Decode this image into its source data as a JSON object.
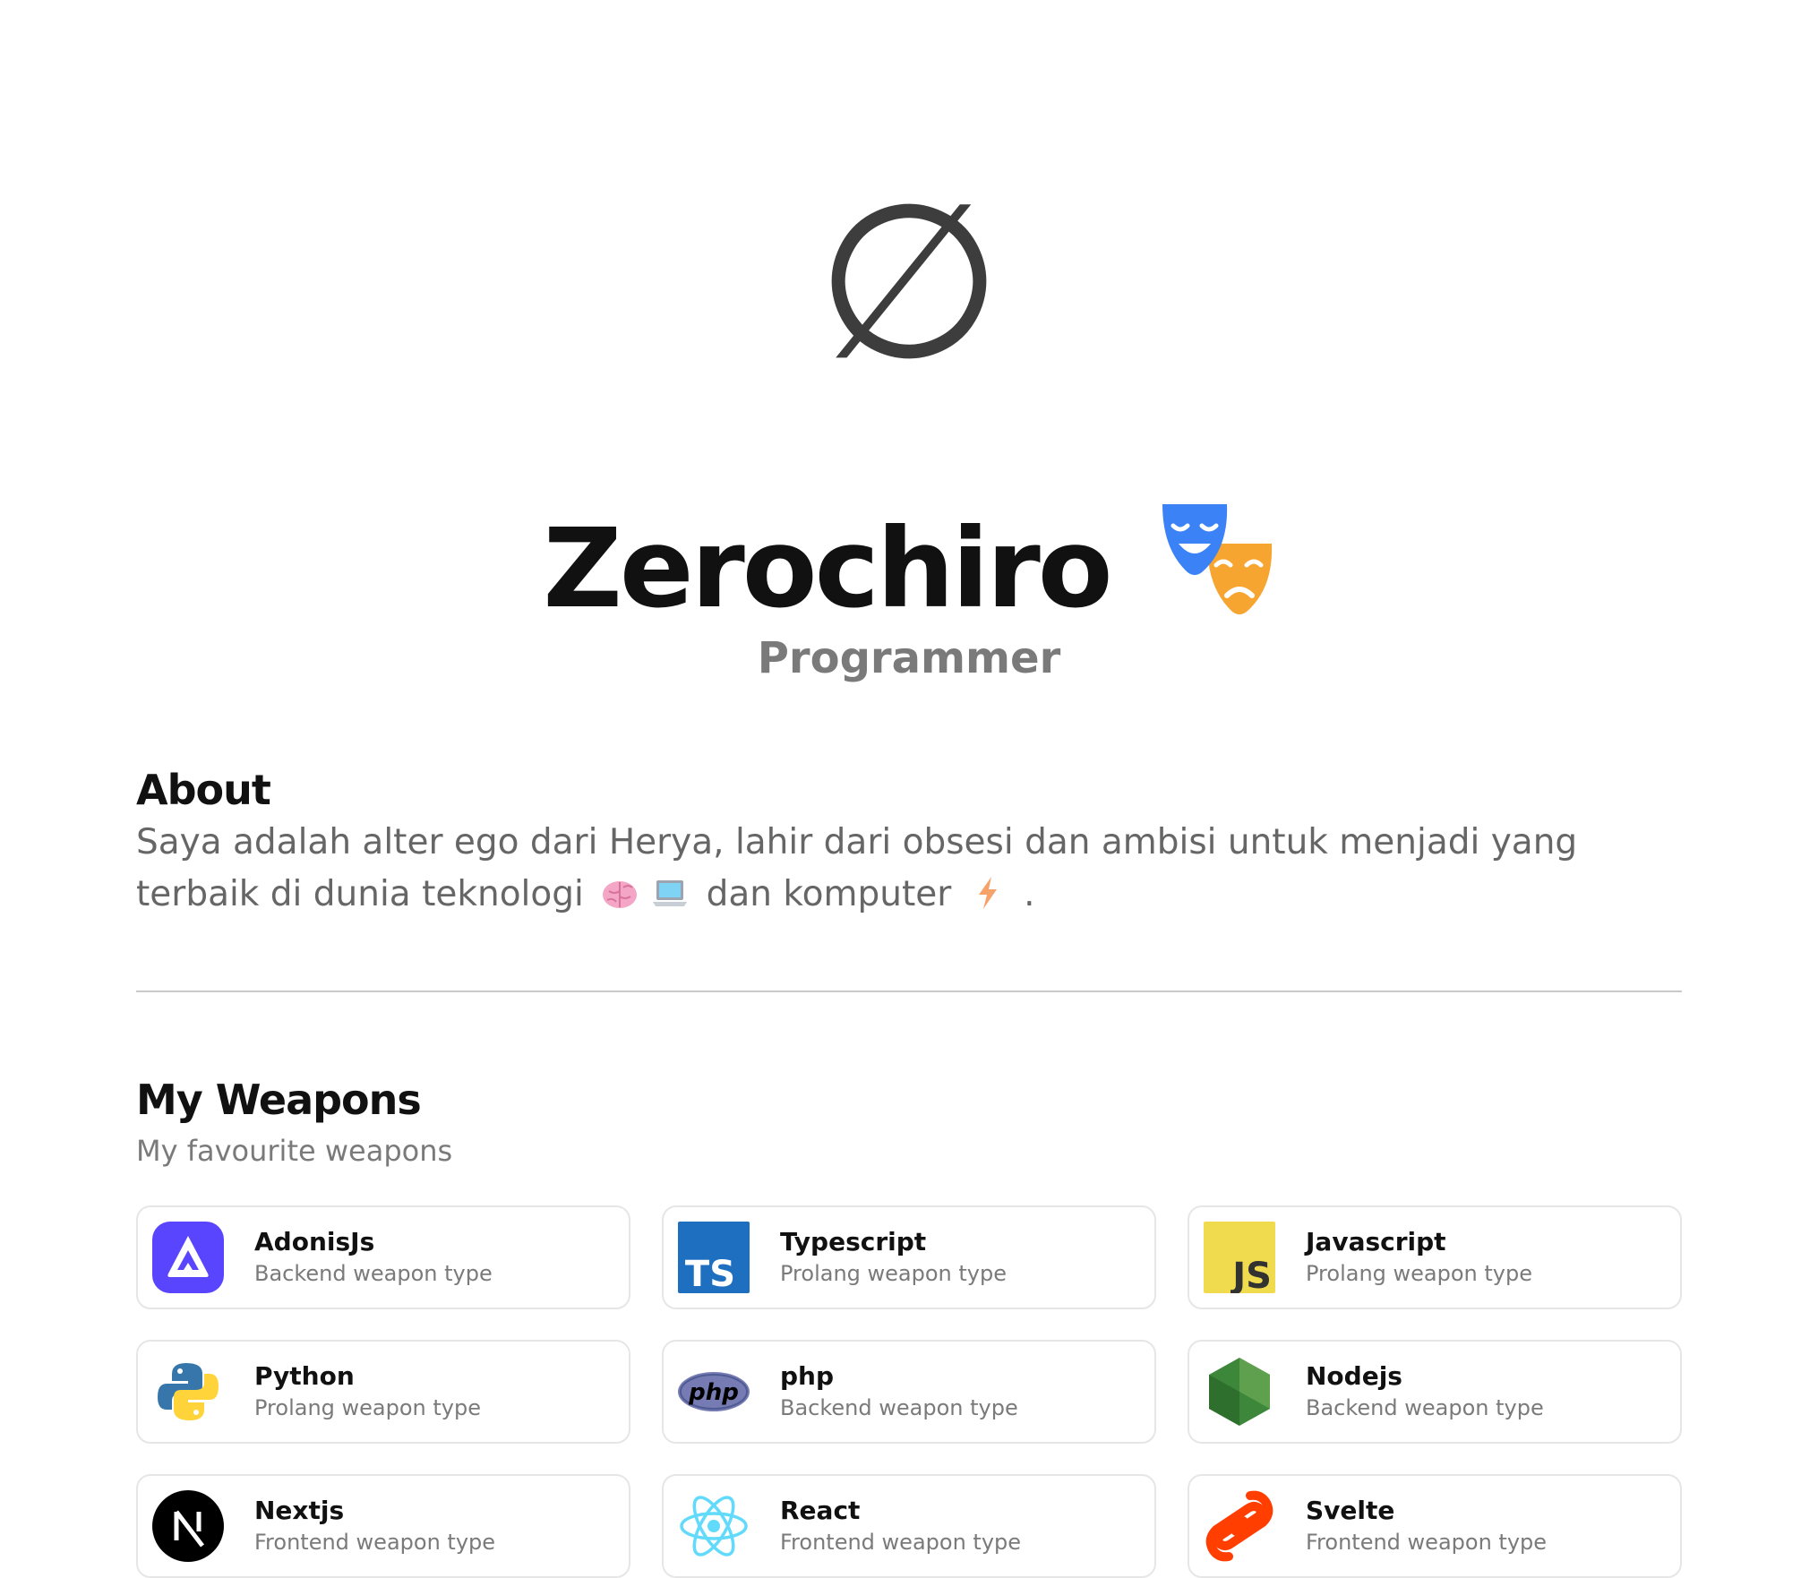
{
  "hero": {
    "logo_glyph": "∅",
    "title": "Zerochiro",
    "subtitle": "Programmer",
    "title_icon": "performing-arts-masks-icon"
  },
  "about": {
    "heading": "About",
    "text_part1": "Saya adalah alter ego dari Herya, lahir dari obsesi dan ambisi untuk menjadi yang terbaik di dunia teknologi",
    "text_part2": "dan komputer",
    "text_part3": ".",
    "emojis": [
      "brain-icon",
      "laptop-icon",
      "lightning-icon"
    ]
  },
  "weapons": {
    "heading": "My Weapons",
    "subtitle": "My favourite weapons",
    "items": [
      {
        "name": "AdonisJs",
        "type": "Backend weapon type",
        "icon": "adonisjs-icon",
        "color": "#5a45ff"
      },
      {
        "name": "Typescript",
        "type": "Prolang weapon type",
        "icon": "typescript-icon",
        "color": "#3178c6"
      },
      {
        "name": "Javascript",
        "type": "Prolang weapon type",
        "icon": "javascript-icon",
        "color": "#f0db4f"
      },
      {
        "name": "Python",
        "type": "Prolang weapon type",
        "icon": "python-icon",
        "color": "#3776ab"
      },
      {
        "name": "php",
        "type": "Backend weapon type",
        "icon": "php-icon",
        "color": "#777bb4"
      },
      {
        "name": "Nodejs",
        "type": "Backend weapon type",
        "icon": "nodejs-icon",
        "color": "#3c873a"
      },
      {
        "name": "Nextjs",
        "type": "Frontend weapon type",
        "icon": "nextjs-icon",
        "color": "#000000"
      },
      {
        "name": "React",
        "type": "Frontend weapon type",
        "icon": "react-icon",
        "color": "#61dafb"
      },
      {
        "name": "Svelte",
        "type": "Frontend weapon type",
        "icon": "svelte-icon",
        "color": "#ff3e00"
      }
    ]
  }
}
